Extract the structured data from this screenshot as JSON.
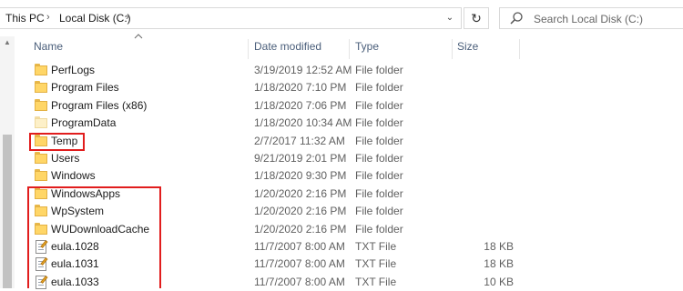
{
  "address": {
    "crumbs": [
      "This PC",
      "Local Disk (C:)"
    ],
    "separator": "›"
  },
  "icons": {
    "chevron": "chevron-right-icon",
    "dropdown": "chevron-down-icon",
    "refresh": "refresh-icon",
    "search": "search-icon",
    "sort": "sort-up-icon",
    "folder": "folder-icon",
    "text_file": "text-file-icon"
  },
  "refresh_glyph": "↻",
  "dropdown_glyph": "⌄",
  "search": {
    "placeholder": "Search Local Disk (C:)"
  },
  "columns": {
    "name": "Name",
    "date": "Date modified",
    "type": "Type",
    "size": "Size"
  },
  "files": [
    {
      "name": "PerfLogs",
      "date": "3/19/2019 12:52 AM",
      "type": "File folder",
      "size": "",
      "kind": "folder"
    },
    {
      "name": "Program Files",
      "date": "1/18/2020 7:10 PM",
      "type": "File folder",
      "size": "",
      "kind": "folder"
    },
    {
      "name": "Program Files (x86)",
      "date": "1/18/2020 7:06 PM",
      "type": "File folder",
      "size": "",
      "kind": "folder"
    },
    {
      "name": "ProgramData",
      "date": "1/18/2020 10:34 AM",
      "type": "File folder",
      "size": "",
      "kind": "folder-hidden"
    },
    {
      "name": "Temp",
      "date": "2/7/2017 11:32 AM",
      "type": "File folder",
      "size": "",
      "kind": "folder"
    },
    {
      "name": "Users",
      "date": "9/21/2019 2:01 PM",
      "type": "File folder",
      "size": "",
      "kind": "folder"
    },
    {
      "name": "Windows",
      "date": "1/18/2020 9:30 PM",
      "type": "File folder",
      "size": "",
      "kind": "folder"
    },
    {
      "name": "WindowsApps",
      "date": "1/20/2020 2:16 PM",
      "type": "File folder",
      "size": "",
      "kind": "folder"
    },
    {
      "name": "WpSystem",
      "date": "1/20/2020 2:16 PM",
      "type": "File folder",
      "size": "",
      "kind": "folder"
    },
    {
      "name": "WUDownloadCache",
      "date": "1/20/2020 2:16 PM",
      "type": "File folder",
      "size": "",
      "kind": "folder"
    },
    {
      "name": "eula.1028",
      "date": "11/7/2007 8:00 AM",
      "type": "TXT File",
      "size": "18 KB",
      "kind": "txt"
    },
    {
      "name": "eula.1031",
      "date": "11/7/2007 8:00 AM",
      "type": "TXT File",
      "size": "18 KB",
      "kind": "txt"
    },
    {
      "name": "eula.1033",
      "date": "11/7/2007 8:00 AM",
      "type": "TXT File",
      "size": "10 KB",
      "kind": "txt"
    }
  ],
  "highlight_color": "#e11d1d"
}
